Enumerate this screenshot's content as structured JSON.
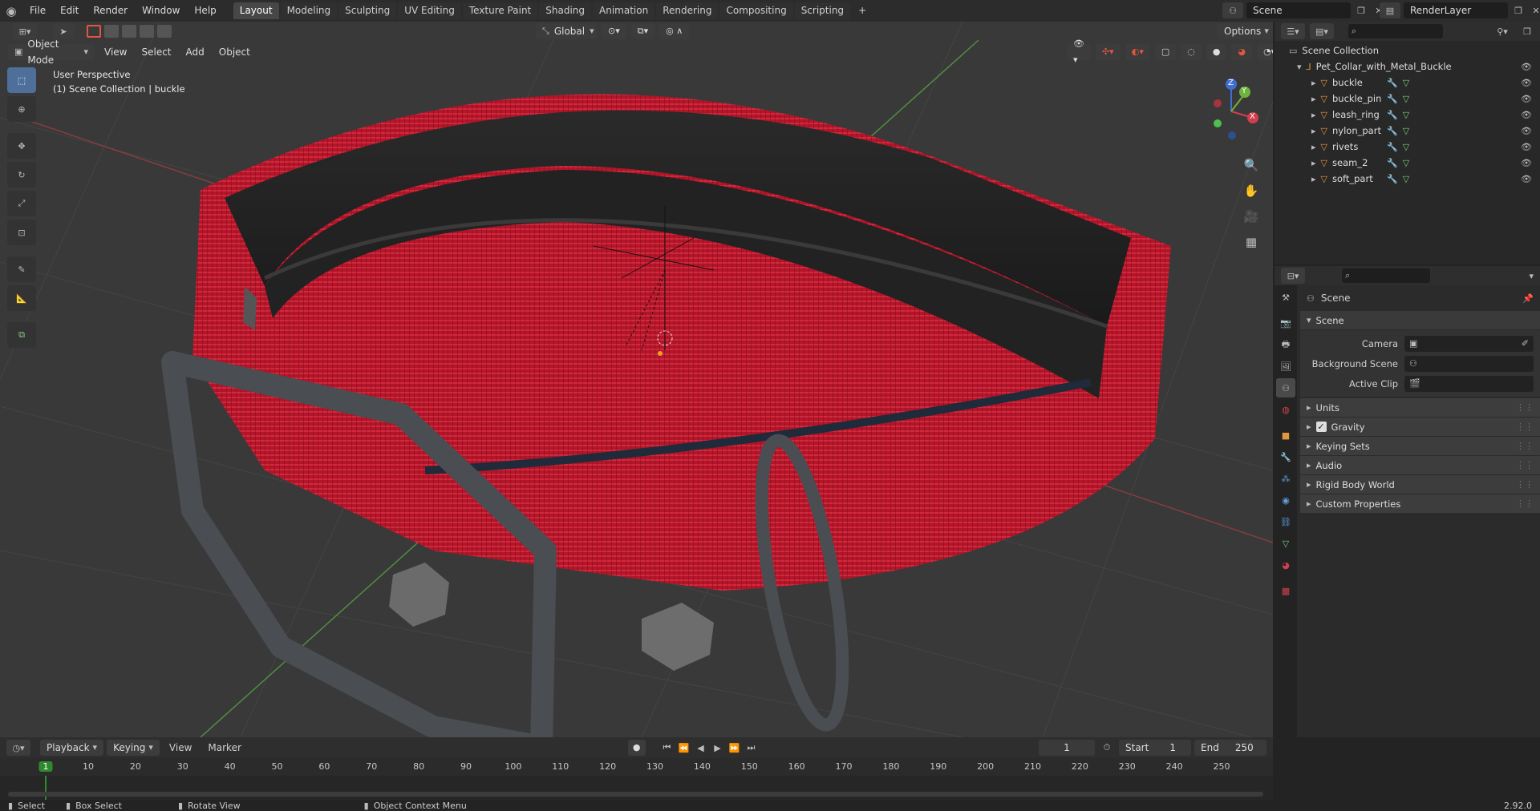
{
  "menu": [
    "File",
    "Edit",
    "Render",
    "Window",
    "Help"
  ],
  "workspaces": [
    "Layout",
    "Modeling",
    "Sculpting",
    "UV Editing",
    "Texture Paint",
    "Shading",
    "Animation",
    "Rendering",
    "Compositing",
    "Scripting"
  ],
  "active_workspace": "Layout",
  "add_workspace": "+",
  "scene_name": "Scene",
  "view_layer": "RenderLayer",
  "viewport": {
    "mode": "Object Mode",
    "menus": [
      "View",
      "Select",
      "Add",
      "Object"
    ],
    "orientation": "Global",
    "options": "Options",
    "perspective": "User Perspective",
    "context": "(1) Scene Collection | buckle",
    "gizmo": {
      "x": "X",
      "y": "Y",
      "z": "Z"
    }
  },
  "outliner": {
    "root": "Scene Collection",
    "collection": "Pet_Collar_with_Metal_Buckle",
    "objects": [
      "buckle",
      "buckle_pin",
      "leash_ring",
      "nylon_part",
      "rivets",
      "seam_2",
      "soft_part"
    ]
  },
  "properties": {
    "header": "Scene",
    "section": "Scene",
    "fields": [
      {
        "label": "Camera",
        "value": ""
      },
      {
        "label": "Background Scene",
        "value": ""
      },
      {
        "label": "Active Clip",
        "value": ""
      }
    ],
    "subsections": [
      "Units",
      "Gravity",
      "Keying Sets",
      "Audio",
      "Rigid Body World",
      "Custom Properties"
    ],
    "gravity_checked": true
  },
  "timeline": {
    "menus": [
      "Playback",
      "Keying",
      "View",
      "Marker"
    ],
    "current_frame": "1",
    "start_label": "Start",
    "start": "1",
    "end_label": "End",
    "end": "250",
    "ruler": [
      "1",
      "10",
      "20",
      "30",
      "40",
      "50",
      "60",
      "70",
      "80",
      "90",
      "100",
      "110",
      "120",
      "130",
      "140",
      "150",
      "160",
      "170",
      "180",
      "190",
      "200",
      "210",
      "220",
      "230",
      "240",
      "250"
    ]
  },
  "status": {
    "select": "Select",
    "box_select": "Box Select",
    "rotate_view": "Rotate View",
    "context_menu": "Object Context Menu",
    "version": "2.92.0"
  },
  "colors": {
    "accent": "#4772b3",
    "collar_red": "#c0182a",
    "active_frame": "#2f8a2f"
  }
}
